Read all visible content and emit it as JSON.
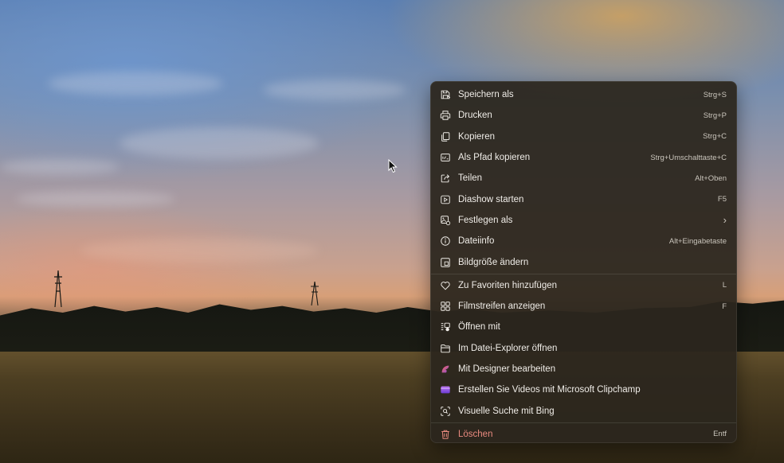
{
  "wallpaper": {
    "description_free": true
  },
  "context_menu": {
    "items": [
      {
        "label": "Speichern als",
        "shortcut": "Strg+S",
        "icon": "save-as-icon"
      },
      {
        "label": "Drucken",
        "shortcut": "Strg+P",
        "icon": "printer-icon"
      },
      {
        "label": "Kopieren",
        "shortcut": "Strg+C",
        "icon": "copy-icon"
      },
      {
        "label": "Als Pfad kopieren",
        "shortcut": "Strg+Umschalttaste+C",
        "icon": "copy-path-icon"
      },
      {
        "label": "Teilen",
        "shortcut": "Alt+Oben",
        "icon": "share-icon"
      },
      {
        "label": "Diashow starten",
        "shortcut": "F5",
        "icon": "slideshow-icon"
      },
      {
        "label": "Festlegen als",
        "shortcut": "›",
        "icon": "set-as-icon"
      },
      {
        "label": "Dateiinfo",
        "shortcut": "Alt+Eingabetaste",
        "icon": "info-icon"
      },
      {
        "label": "Bildgröße ändern",
        "shortcut": "",
        "icon": "resize-icon"
      },
      {
        "label": "Zu Favoriten hinzufügen",
        "shortcut": "L",
        "icon": "heart-icon"
      },
      {
        "label": "Filmstreifen anzeigen",
        "shortcut": "F",
        "icon": "filmstrip-icon"
      },
      {
        "label": "Öffnen mit",
        "shortcut": "",
        "icon": "open-with-icon"
      },
      {
        "label": "Im Datei-Explorer öffnen",
        "shortcut": "",
        "icon": "folder-icon"
      },
      {
        "label": "Mit Designer bearbeiten",
        "shortcut": "",
        "icon": "designer-icon"
      },
      {
        "label": "Erstellen Sie Videos mit Microsoft Clipchamp",
        "shortcut": "",
        "icon": "clipchamp-icon"
      },
      {
        "label": "Visuelle Suche mit Bing",
        "shortcut": "",
        "icon": "visual-search-icon"
      },
      {
        "label": "Löschen",
        "shortcut": "Entf",
        "icon": "trash-icon"
      }
    ]
  },
  "colors": {
    "menu_bg": "#2c261e",
    "text": "#f0ede8",
    "danger": "#e98a7f",
    "designer_gradient": [
      "#e7484f",
      "#8f4bd8"
    ],
    "clipchamp_gradient": [
      "#b25cf0",
      "#6a3ad1"
    ]
  }
}
